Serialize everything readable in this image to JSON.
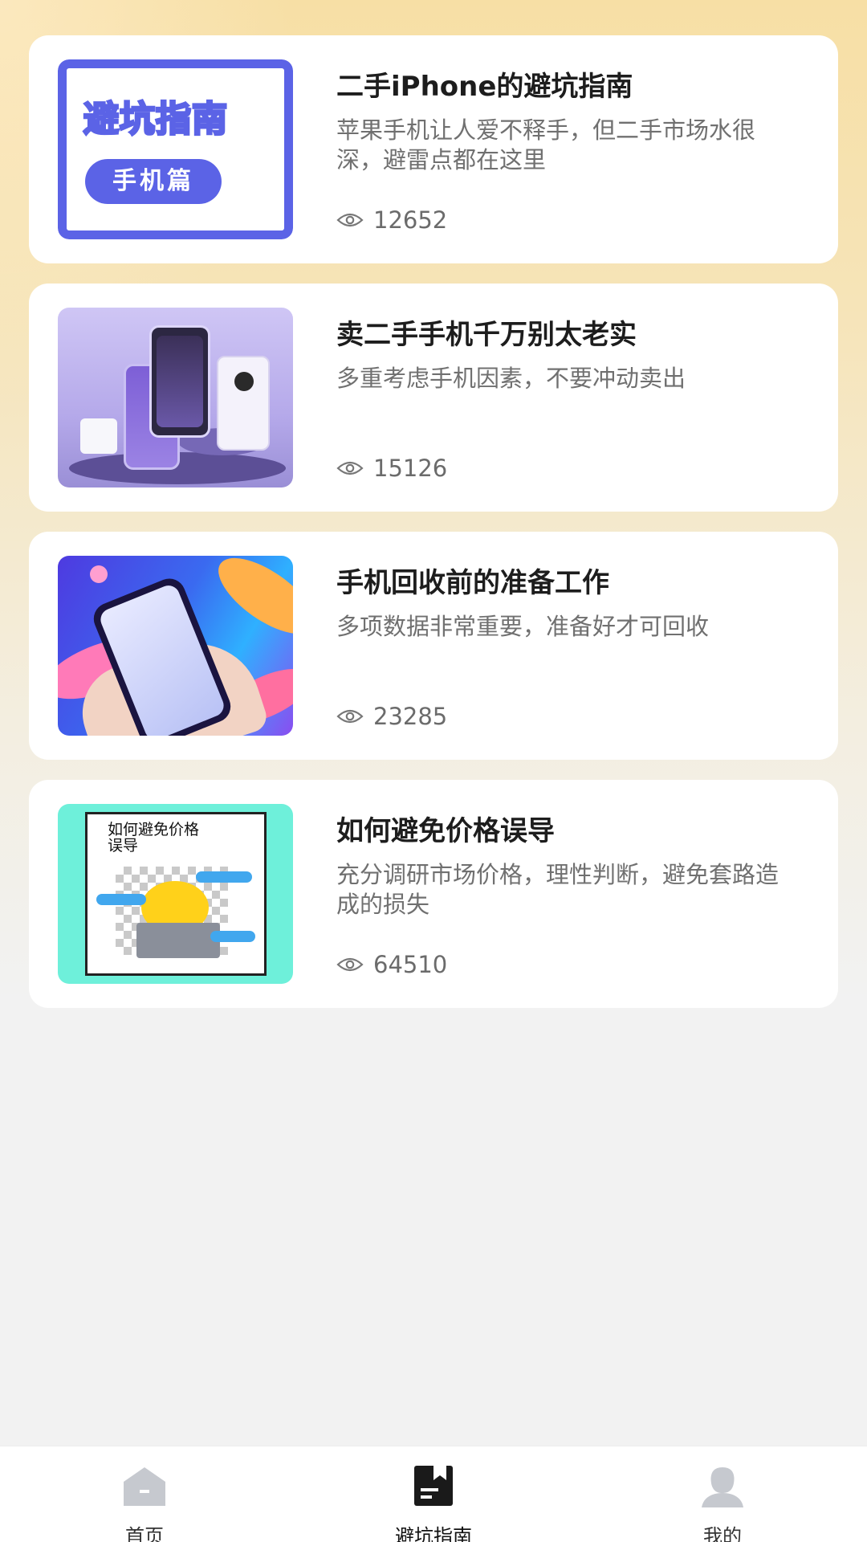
{
  "articles": [
    {
      "title": "二手iPhone的避坑指南",
      "desc": "苹果手机让人爱不释手，但二手市场水很深，避雷点都在这里",
      "views": "12652",
      "thumb": {
        "heading": "避坑指南",
        "pill": "手机篇"
      }
    },
    {
      "title": "卖二手手机千万别太老实",
      "desc": "多重考虑手机因素，不要冲动卖出",
      "views": "15126"
    },
    {
      "title": "手机回收前的准备工作",
      "desc": "多项数据非常重要，准备好才可回收",
      "views": "23285"
    },
    {
      "title": "如何避免价格误导",
      "desc": "充分调研市场价格，理性判断，避免套路造成的损失",
      "views": "64510",
      "thumb": {
        "caption_line1": "如何避免价格",
        "caption_line2": "误导"
      }
    }
  ],
  "tabbar": {
    "items": [
      {
        "label": "首页",
        "icon": "home-icon",
        "active": false
      },
      {
        "label": "避坑指南",
        "icon": "guide-icon",
        "active": true
      },
      {
        "label": "我的",
        "icon": "profile-icon",
        "active": false
      }
    ],
    "active_color": "#1a1a1a",
    "inactive_color": "#c6c9cf"
  }
}
